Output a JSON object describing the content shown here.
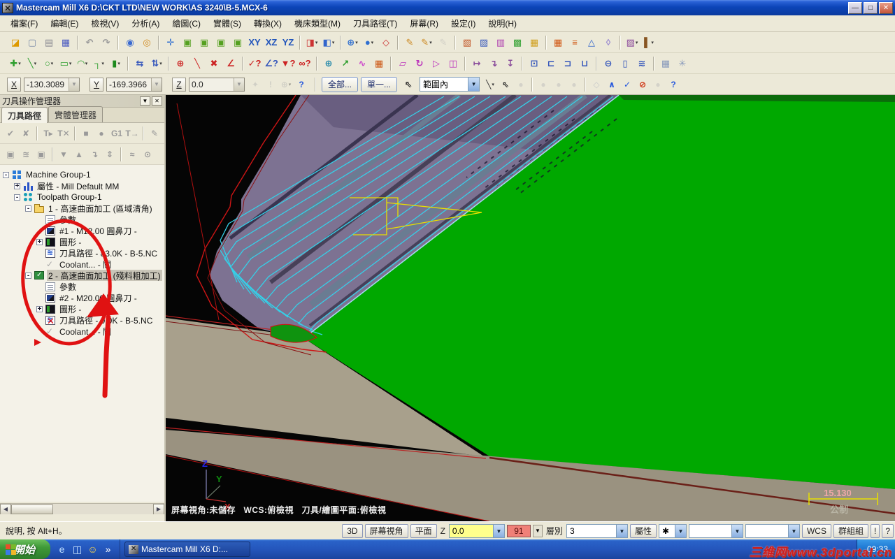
{
  "window": {
    "title": "Mastercam Mill X6  D:\\CKT LTD\\NEW WORK\\AS 3240\\B-5.MCX-6",
    "minimize": "—",
    "restore": "□",
    "close": "✕"
  },
  "menu": {
    "items": [
      "檔案(F)",
      "編輯(E)",
      "檢視(V)",
      "分析(A)",
      "繪圖(C)",
      "實體(S)",
      "轉換(X)",
      "機床類型(M)",
      "刀具路徑(T)",
      "屏幕(R)",
      "設定(I)",
      "說明(H)"
    ]
  },
  "toolbar1": {
    "icons": [
      {
        "name": "open-file",
        "glyph": "◪",
        "color": "#dd9900"
      },
      {
        "name": "new-file",
        "glyph": "▢",
        "color": "#7a8aa8"
      },
      {
        "name": "print",
        "glyph": "▤",
        "color": "#8a8a92"
      },
      {
        "name": "save",
        "glyph": "▦",
        "color": "#4a5ac0"
      },
      {
        "sep": true
      },
      {
        "name": "undo",
        "glyph": "↶",
        "color": "#9a9a9a"
      },
      {
        "name": "redo",
        "glyph": "↷",
        "color": "#9a9a9a"
      },
      {
        "sep": true
      },
      {
        "name": "zoom-window",
        "glyph": "◉",
        "color": "#3a6ad0"
      },
      {
        "name": "zoom-target",
        "glyph": "◎",
        "color": "#d08a20"
      },
      {
        "sep": true
      },
      {
        "name": "fit-screen",
        "glyph": "✛",
        "color": "#2f6fd0"
      },
      {
        "name": "gview-top",
        "glyph": "▣",
        "color": "#55a020"
      },
      {
        "name": "gview-front",
        "glyph": "▣",
        "color": "#55a020"
      },
      {
        "name": "gview-right",
        "glyph": "▣",
        "color": "#55a020"
      },
      {
        "name": "gview-isometric",
        "glyph": "▣",
        "color": "#55a020"
      },
      {
        "name": "plane-xy",
        "glyph": "XY",
        "color": "#2255bb"
      },
      {
        "name": "plane-xz",
        "glyph": "XZ",
        "color": "#2255bb"
      },
      {
        "name": "plane-yz",
        "glyph": "YZ",
        "color": "#2255bb"
      },
      {
        "sep": true
      },
      {
        "name": "gview-cube",
        "glyph": "◨",
        "color": "#cc3333",
        "dd": true
      },
      {
        "name": "cplane-cube",
        "glyph": "◧",
        "color": "#3366cc",
        "dd": true
      },
      {
        "sep": true
      },
      {
        "name": "wcs-globe",
        "glyph": "⊕",
        "color": "#2f6fd0",
        "dd": true
      },
      {
        "name": "shading",
        "glyph": "●",
        "color": "#2f6fd0",
        "dd": true
      },
      {
        "name": "wireframe-box",
        "glyph": "◇",
        "color": "#cc3333"
      },
      {
        "sep": true
      },
      {
        "name": "delete-entity",
        "glyph": "✎",
        "color": "#cc8820"
      },
      {
        "name": "delete-extra",
        "glyph": "✎",
        "color": "#cc8820",
        "dd": true
      },
      {
        "name": "undelete",
        "glyph": "✎",
        "color": "#b0b0b0",
        "dis": true
      },
      {
        "sep": true
      },
      {
        "name": "screen-config-1",
        "glyph": "▧",
        "color": "#c05020"
      },
      {
        "name": "screen-config-2",
        "glyph": "▨",
        "color": "#3355bb"
      },
      {
        "name": "screen-config-3",
        "glyph": "▥",
        "color": "#b040b0"
      },
      {
        "name": "screen-config-4",
        "glyph": "▩",
        "color": "#30a030"
      },
      {
        "name": "screen-config-5",
        "glyph": "▦",
        "color": "#d0a020"
      },
      {
        "sep": true
      },
      {
        "name": "grid-settings",
        "glyph": "▦",
        "color": "#d05510"
      },
      {
        "name": "level-manager",
        "glyph": "≡",
        "color": "#d05510"
      },
      {
        "name": "hide-entity",
        "glyph": "△",
        "color": "#3366cc"
      },
      {
        "name": "blank-entity",
        "glyph": "◊",
        "color": "#9a8ad0"
      },
      {
        "sep": true
      },
      {
        "name": "analyze-pattern",
        "glyph": "▨",
        "color": "#884499",
        "dd": true
      },
      {
        "name": "attribute-brush",
        "glyph": "▌",
        "color": "#885522",
        "dd": true
      }
    ]
  },
  "toolbar2": {
    "icons": [
      {
        "name": "create-point",
        "glyph": "✚",
        "color": "#2f9f2f",
        "dd": true
      },
      {
        "name": "create-line",
        "glyph": "╲",
        "color": "#2f9f2f",
        "dd": true
      },
      {
        "name": "create-arc",
        "glyph": "○",
        "color": "#2f9f2f",
        "dd": true
      },
      {
        "name": "create-rectangle",
        "glyph": "▭",
        "color": "#2f9f2f",
        "dd": true
      },
      {
        "name": "create-fillet",
        "glyph": "◠",
        "color": "#2f9f2f",
        "dd": true
      },
      {
        "name": "create-chamfer",
        "glyph": "┐",
        "color": "#2f9f2f",
        "dd": true
      },
      {
        "name": "create-solid",
        "glyph": "▮",
        "color": "#1e8a1e",
        "dd": true
      },
      {
        "sep": true
      },
      {
        "name": "xform-mirror",
        "glyph": "⇆",
        "color": "#3355bb"
      },
      {
        "name": "xform-translate",
        "glyph": "⇅",
        "color": "#3355bb",
        "dd": true
      },
      {
        "sep": true
      },
      {
        "name": "analyze-position",
        "glyph": "⊕",
        "color": "#cc2222"
      },
      {
        "name": "analyze-distance",
        "glyph": "╲",
        "color": "#cc2222"
      },
      {
        "name": "analyze-dynamic",
        "glyph": "✖",
        "color": "#cc2222"
      },
      {
        "name": "analyze-angle",
        "glyph": "∠",
        "color": "#cc2222"
      },
      {
        "sep": true
      },
      {
        "name": "analyze-entity",
        "glyph": "✓?",
        "color": "#cc2222"
      },
      {
        "name": "analyze-surface",
        "glyph": "∠?",
        "color": "#3355bb"
      },
      {
        "name": "analyze-volume",
        "glyph": "▼?",
        "color": "#cc2222"
      },
      {
        "name": "analyze-chain",
        "glyph": "∞?",
        "color": "#cc2222"
      },
      {
        "sep": true
      },
      {
        "name": "curve-sphere",
        "glyph": "⊕",
        "color": "#2288aa"
      },
      {
        "name": "curve-one-edge",
        "glyph": "↗",
        "color": "#2f9f2f"
      },
      {
        "name": "curve-flowline",
        "glyph": "∿",
        "color": "#cc44cc"
      },
      {
        "name": "surface-grid",
        "glyph": "▦",
        "color": "#cc5511"
      },
      {
        "sep": true
      },
      {
        "name": "xform-offset",
        "glyph": "▱",
        "color": "#bb33bb"
      },
      {
        "name": "xform-rotate",
        "glyph": "↻",
        "color": "#bb33bb"
      },
      {
        "name": "xform-scale",
        "glyph": "▷",
        "color": "#bb33bb"
      },
      {
        "name": "xform-mirror-2",
        "glyph": "◫",
        "color": "#bb33bb"
      },
      {
        "sep": true
      },
      {
        "name": "xform-project",
        "glyph": "↦",
        "color": "#884a9a"
      },
      {
        "name": "xform-roll",
        "glyph": "↴",
        "color": "#884a9a"
      },
      {
        "name": "xform-drag",
        "glyph": "↧",
        "color": "#884a9a"
      },
      {
        "sep": true
      },
      {
        "name": "machine-pocket",
        "glyph": "⊡",
        "color": "#3355bb"
      },
      {
        "name": "machine-contour",
        "glyph": "⊏",
        "color": "#3355bb"
      },
      {
        "name": "machine-face",
        "glyph": "⊐",
        "color": "#3355bb"
      },
      {
        "name": "machine-drill",
        "glyph": "⊔",
        "color": "#3355bb"
      },
      {
        "sep": true
      },
      {
        "name": "view-section",
        "glyph": "⊖",
        "color": "#3355bb"
      },
      {
        "name": "view-capsule",
        "glyph": "▯",
        "color": "#3355bb"
      },
      {
        "name": "view-layers",
        "glyph": "≋",
        "color": "#3355bb"
      },
      {
        "sep": true
      },
      {
        "name": "selection-grid",
        "glyph": "▦",
        "color": "#8899bb"
      },
      {
        "name": "expand-view",
        "glyph": "✳",
        "color": "#8899bb"
      }
    ]
  },
  "coordbar": {
    "x_label": "X",
    "x_value": "-130.3089",
    "y_label": "Y",
    "y_value": "-169.3966",
    "z_label": "Z",
    "z_value": "0.0",
    "all_button": "全部...",
    "single_button": "單一...",
    "range_select": "範圍內",
    "icons1": [
      {
        "name": "fastpoint",
        "glyph": "✦",
        "color": "#b0b0b0",
        "dis": true
      },
      {
        "name": "guess-point",
        "glyph": "!",
        "color": "#b0b0b0",
        "dis": true
      },
      {
        "name": "origin-point",
        "glyph": "⊕",
        "color": "#b0b0b0",
        "dis": true,
        "dd": true
      },
      {
        "name": "autocursor-help",
        "glyph": "?",
        "color": "#2255dd"
      }
    ],
    "icons2": [
      {
        "name": "chain-line",
        "glyph": "╲",
        "color": "#333333",
        "dd": true
      },
      {
        "name": "select-cursor",
        "glyph": "⇖",
        "color": "#222222"
      },
      {
        "name": "select-last",
        "glyph": "●",
        "color": "#b8b8b8",
        "dis": true
      },
      {
        "sep": true
      },
      {
        "name": "select-window",
        "glyph": "●",
        "color": "#b8b8b8",
        "dis": true
      },
      {
        "name": "select-polygon",
        "glyph": "●",
        "color": "#b8b8b8",
        "dis": true
      },
      {
        "name": "select-single",
        "glyph": "●",
        "color": "#b8b8b8",
        "dis": true
      },
      {
        "sep": true
      },
      {
        "name": "select-solids",
        "glyph": "◇",
        "color": "#9aa4b8",
        "dis": true
      },
      {
        "name": "select-up",
        "glyph": "∧",
        "color": "#2255dd"
      },
      {
        "name": "select-validate",
        "glyph": "✓",
        "color": "#2255dd"
      },
      {
        "name": "select-clear",
        "glyph": "⊘",
        "color": "#cc2200"
      },
      {
        "name": "select-redo",
        "glyph": "●",
        "color": "#b8b8b8",
        "dis": true
      },
      {
        "name": "quick-help",
        "glyph": "?",
        "color": "#2255dd"
      }
    ]
  },
  "manager": {
    "title": "刀具操作管理器",
    "collapse_button": "▼",
    "close_button": "✕",
    "tabs": [
      {
        "label": "刀具路徑"
      },
      {
        "label": "實體管理器"
      }
    ],
    "toolbar_row1": [
      {
        "name": "select-all-ops",
        "glyph": "✔",
        "color": "#9a9a9a"
      },
      {
        "name": "deselect-all-ops",
        "glyph": "✘",
        "color": "#9a9a9a"
      },
      {
        "sep": true
      },
      {
        "name": "regen-selected",
        "glyph": "T▸",
        "color": "#9a9a9a"
      },
      {
        "name": "regen-dirty",
        "glyph": "T✕",
        "color": "#9a9a9a"
      },
      {
        "sep": true
      },
      {
        "name": "verify-stop",
        "glyph": "■",
        "color": "#9a9a9a"
      },
      {
        "name": "verify-solid",
        "glyph": "●",
        "color": "#9a9a9a"
      },
      {
        "name": "g1-backplot",
        "glyph": "G1",
        "color": "#9a9a9a"
      },
      {
        "name": "post-selected",
        "glyph": "T→",
        "color": "#9a9a9a"
      },
      {
        "sep": true
      },
      {
        "name": "highfeed-edit",
        "glyph": "✎",
        "color": "#9a9a9a"
      }
    ],
    "toolbar_row2": [
      {
        "name": "lock-selected",
        "glyph": "▣",
        "color": "#9a9a9a"
      },
      {
        "name": "toolpath-display",
        "glyph": "≋",
        "color": "#9a9a9a"
      },
      {
        "name": "lock-toolpath",
        "glyph": "▣",
        "color": "#9a9a9a"
      },
      {
        "sep": true
      },
      {
        "name": "move-down",
        "glyph": "▼",
        "color": "#9a9a9a"
      },
      {
        "name": "move-up",
        "glyph": "▲",
        "color": "#9a9a9a"
      },
      {
        "name": "move-insert",
        "glyph": "↴",
        "color": "#9a9a9a"
      },
      {
        "name": "scroll-insert",
        "glyph": "⇕",
        "color": "#9a9a9a"
      },
      {
        "sep": true
      },
      {
        "name": "hide-toolpath",
        "glyph": "≈",
        "color": "#9a9a9a"
      },
      {
        "name": "select-associated",
        "glyph": "⊙",
        "color": "#9a9a9a"
      }
    ],
    "tree": [
      {
        "level": 0,
        "exp": "-",
        "icon": "machine",
        "label": "Machine Group-1"
      },
      {
        "level": 1,
        "exp": "+",
        "icon": "properties",
        "label": "屬性 - Mill Default MM"
      },
      {
        "level": 1,
        "exp": "-",
        "icon": "tpgroup",
        "label": "Toolpath Group-1"
      },
      {
        "level": 2,
        "exp": "-",
        "icon": "folder",
        "label": "1 - 高速曲面加工 (區域清角)"
      },
      {
        "level": 3,
        "exp": "",
        "icon": "params",
        "label": "參數"
      },
      {
        "level": 3,
        "exp": "",
        "icon": "tool",
        "label": "#1 - M12.00 圓鼻刀 -"
      },
      {
        "level": 3,
        "exp": "+",
        "icon": "geometry",
        "label": "圖形 -"
      },
      {
        "level": 3,
        "exp": "",
        "icon": "toolpath",
        "label": "刀具路徑 - 83.0K - B-5.NC"
      },
      {
        "level": 3,
        "exp": "",
        "icon": "coolant",
        "label": "Coolant... - 關"
      },
      {
        "level": 2,
        "exp": "-",
        "icon": "folder2",
        "label": "2 - 高速曲面加工 (殘料粗加工)",
        "selected": true
      },
      {
        "level": 3,
        "exp": "",
        "icon": "params",
        "label": "參數"
      },
      {
        "level": 3,
        "exp": "",
        "icon": "tool",
        "label": "#2 - M20.00 圓鼻刀 -"
      },
      {
        "level": 3,
        "exp": "+",
        "icon": "geometry",
        "label": "圖形 -"
      },
      {
        "level": 3,
        "exp": "",
        "icon": "toolpathx",
        "label": "刀具路徑 - 0.0K - B-5.NC"
      },
      {
        "level": 3,
        "exp": "",
        "icon": "coolant",
        "label": "Coolant... - 關"
      },
      {
        "level": 2,
        "exp": "",
        "icon": "insert",
        "label": ""
      }
    ],
    "scroll_left": "◀",
    "scroll_right": "▶"
  },
  "viewport": {
    "status_line": "屏幕視角:未儲存   WCS:俯檢視   刀具/繪圖平面:俯檢視",
    "scale_value": "15.130",
    "scale_unit": "公制",
    "axis_x": "X",
    "axis_y": "Y",
    "axis_z": "Z"
  },
  "statusbar": {
    "help_text": "說明, 按 Alt+H。",
    "btn_3d": "3D",
    "btn_screen_view": "屏幕視角",
    "btn_plane": "平面",
    "z_label": "Z",
    "z_value": "0.0",
    "color_value": "91",
    "level_label": "層別",
    "level_value": "3",
    "btn_attributes": "屬性",
    "point_style": "✱",
    "btn_wcs": "WCS",
    "btn_group": "群組組",
    "btn_bang": "!",
    "btn_help": "?"
  },
  "taskbar": {
    "start": "開始",
    "quick_launch": [
      {
        "name": "ie-browser",
        "glyph": "e",
        "color": "#bfe0ff"
      },
      {
        "name": "explorer",
        "glyph": "◫",
        "color": "#cfe8ff"
      },
      {
        "name": "messenger-smiley",
        "glyph": "☺",
        "color": "#ffd84a"
      },
      {
        "name": "chevron",
        "glyph": "»",
        "color": "#ffffff"
      }
    ],
    "task": "Mastercam Mill X6  D:...",
    "tray_time": "09:33",
    "watermark": "三维网www.3dportal.cn"
  }
}
